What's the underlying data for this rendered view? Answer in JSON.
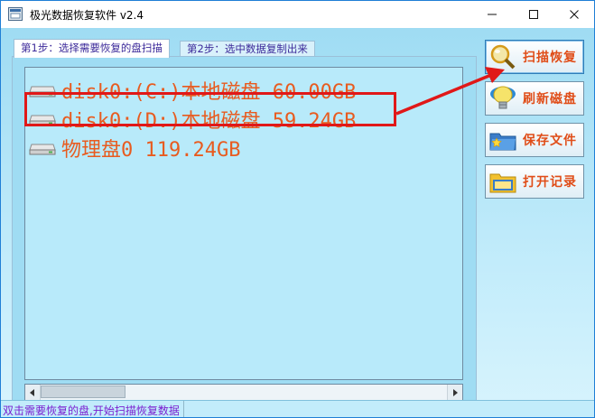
{
  "window": {
    "title": "极光数据恢复软件 v2.4"
  },
  "tabs": [
    {
      "label": "第1步：选择需要恢复的盘扫描",
      "active": true
    },
    {
      "label": "第2步：选中数据复制出来",
      "active": false
    }
  ],
  "drives": [
    {
      "label": "disk0:(C:)本地磁盘 60.00GB",
      "icon": "drive-icon"
    },
    {
      "label": "disk0:(D:)本地磁盘 59.24GB",
      "icon": "drive-icon",
      "highlighted": true
    },
    {
      "label": "物理盘0 119.24GB",
      "icon": "drive-icon"
    }
  ],
  "actions": [
    {
      "label": "扫描恢复",
      "icon": "magnifier-icon"
    },
    {
      "label": "刷新磁盘",
      "icon": "refresh-bulb-icon"
    },
    {
      "label": "保存文件",
      "icon": "save-folder-icon"
    },
    {
      "label": "打开记录",
      "icon": "open-folder-icon"
    }
  ],
  "status": {
    "text": "双击需要恢复的盘,开始扫描恢复数据"
  },
  "colors": {
    "accent_text": "#e85b1f",
    "highlight": "#e01818",
    "status_text": "#7a1ed0",
    "background": "#b9e9f8"
  }
}
